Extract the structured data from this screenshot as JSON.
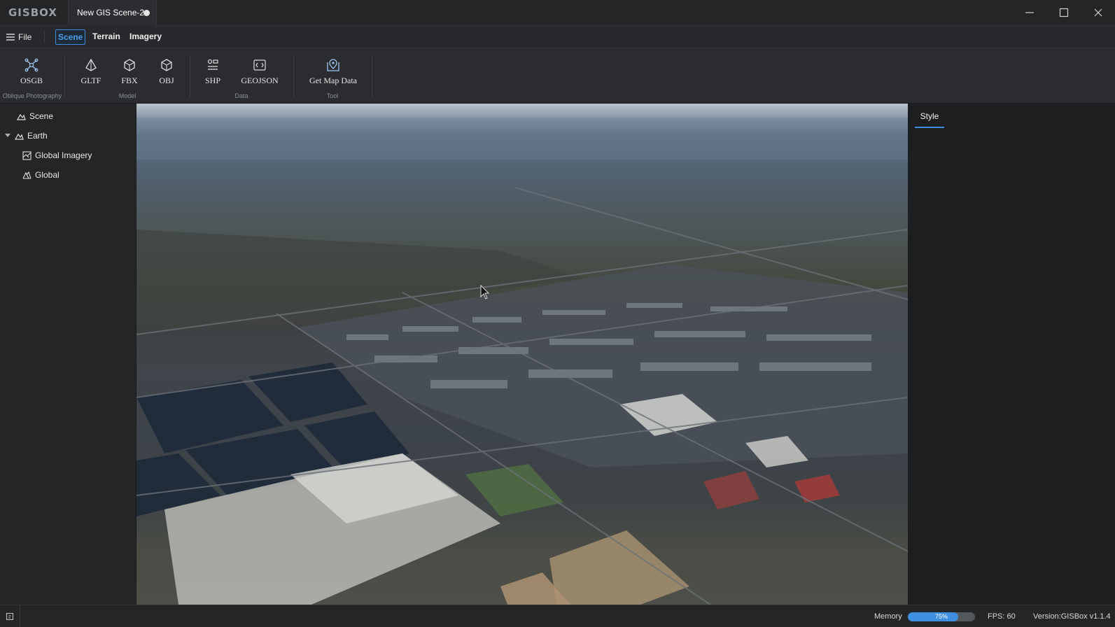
{
  "app": {
    "logo": "GISBOX"
  },
  "doc_tab": {
    "title": "New GIS Scene-2"
  },
  "menubar": {
    "file_label": "File",
    "tabs": [
      {
        "label": "Scene",
        "active": true
      },
      {
        "label": "Terrain",
        "active": false
      },
      {
        "label": "Imagery",
        "active": false
      }
    ]
  },
  "ribbon": {
    "items": [
      {
        "label": "OSGB",
        "icon": "osgb-icon"
      },
      {
        "label": "GLTF",
        "icon": "gltf-icon"
      },
      {
        "label": "FBX",
        "icon": "fbx-icon"
      },
      {
        "label": "OBJ",
        "icon": "obj-icon"
      },
      {
        "label": "SHP",
        "icon": "shp-icon"
      },
      {
        "label": "GEOJSON",
        "icon": "geojson-icon"
      },
      {
        "label": "Get Map Data",
        "icon": "map-pin-icon"
      }
    ],
    "groups": [
      "Oblique Photography",
      "Model",
      "Data",
      "Tool"
    ]
  },
  "tree": {
    "items": [
      {
        "label": "Scene",
        "icon": "scene-icon"
      },
      {
        "label": "Earth",
        "icon": "earth-icon",
        "expanded": true
      },
      {
        "label": "Global Imagery",
        "icon": "imagery-icon"
      },
      {
        "label": "Global",
        "icon": "terrain-icon"
      }
    ]
  },
  "right_panel": {
    "tab": "Style"
  },
  "status": {
    "memory_label": "Memory",
    "memory_percent": 75,
    "memory_text": "75%",
    "fps": "FPS: 60",
    "version": "Version:GISBox v1.1.4"
  },
  "colors": {
    "accent": "#3d8bdc",
    "background": "#1f2123"
  }
}
